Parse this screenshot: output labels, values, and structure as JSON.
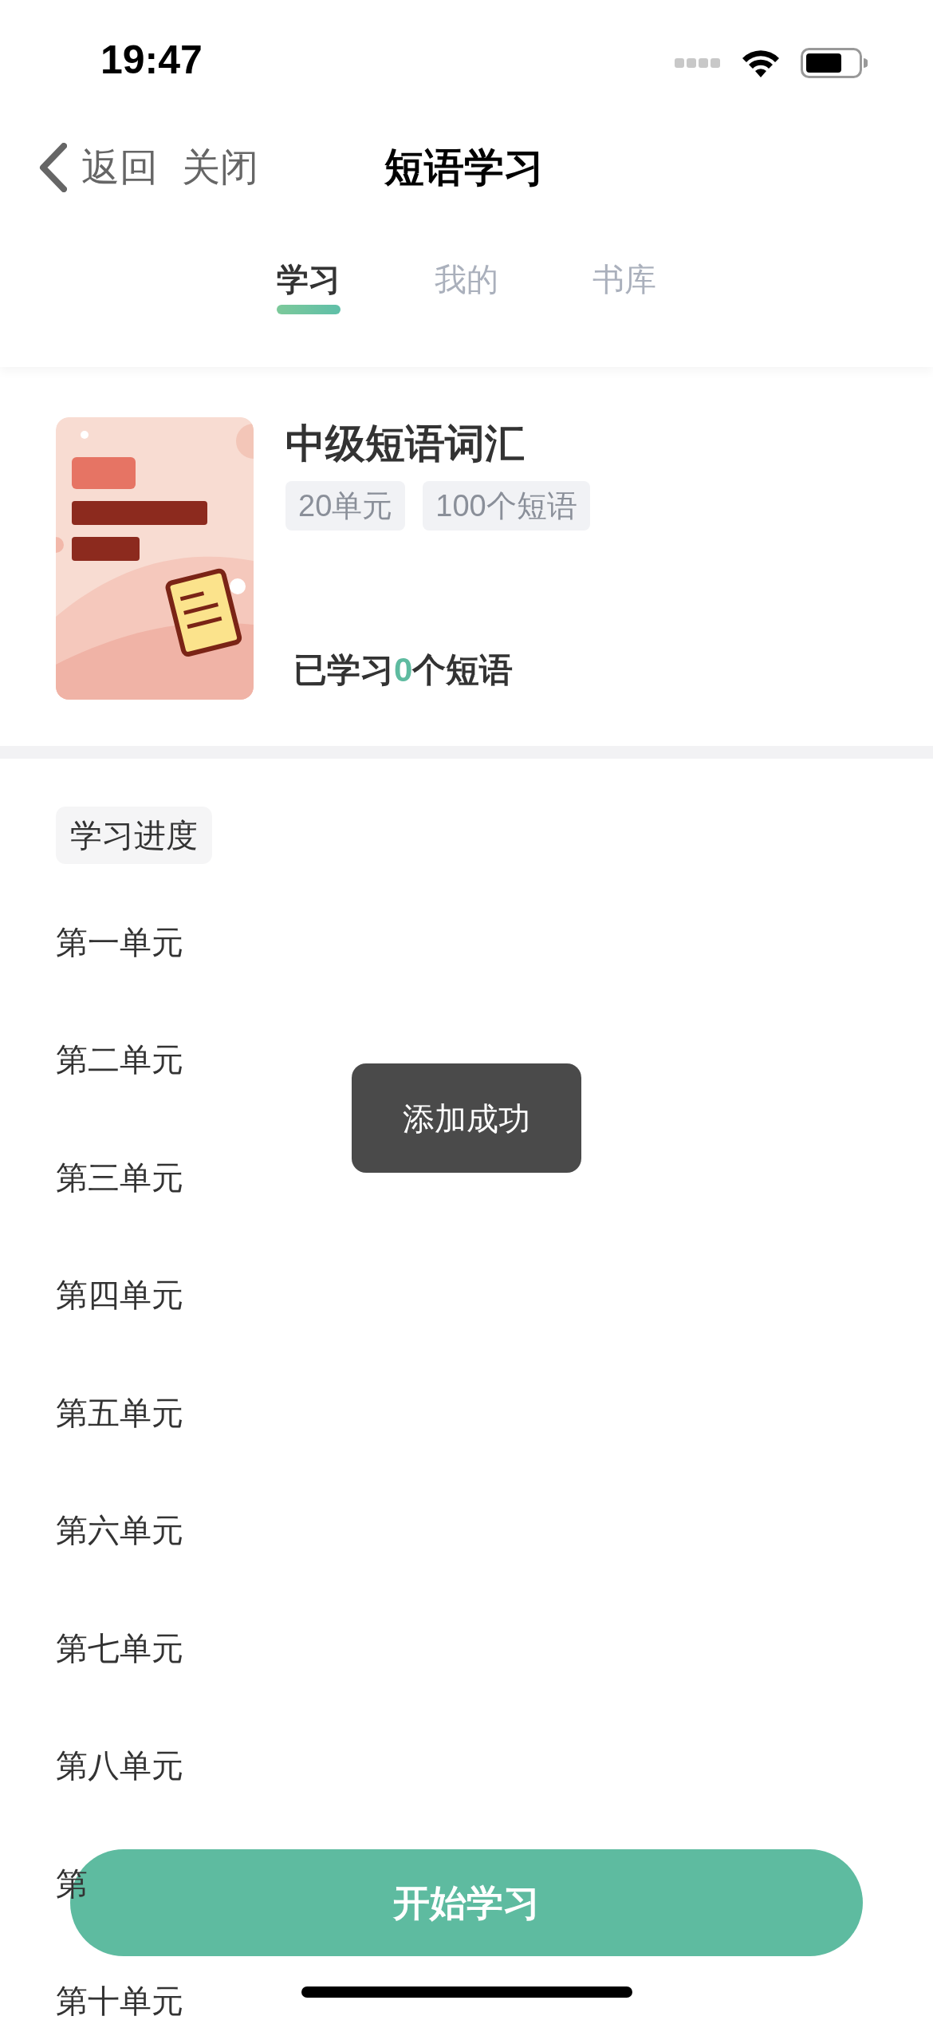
{
  "status_bar": {
    "time": "19:47"
  },
  "nav": {
    "back": "返回",
    "close": "关闭",
    "title": "短语学习"
  },
  "tabs": [
    {
      "label": "学习",
      "selected": true
    },
    {
      "label": "我的",
      "selected": false
    },
    {
      "label": "书库",
      "selected": false
    }
  ],
  "book": {
    "cover": {
      "kind": "picture"
    },
    "title": "中级短语词汇",
    "tags": [
      "20单元",
      "100个短语"
    ],
    "progress": {
      "before": "已学习",
      "count": "0",
      "after": "个短语"
    }
  },
  "progress_section": {
    "heading": "学习进度",
    "units": [
      "第一单元",
      "第二单元",
      "第三单元",
      "第四单元",
      "第五单元",
      "第六单元",
      "第七单元",
      "第八单元",
      "第",
      "第十单元"
    ]
  },
  "toast": "添加成功",
  "start_button": "开始学习"
}
